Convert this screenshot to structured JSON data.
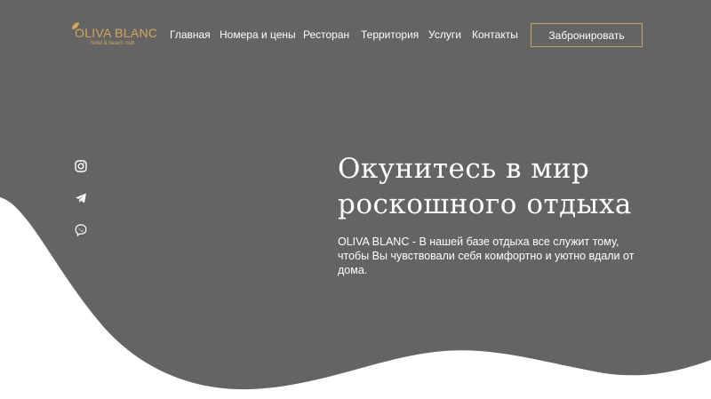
{
  "colors": {
    "background": "#646464",
    "accent_gold": "#d4a45a",
    "wave_cream": "#fbf7ee",
    "wave_white": "#ffffff",
    "text": "#ffffff"
  },
  "logo": {
    "title": "OLIVA BLANC",
    "subtitle": "hotel & beach club",
    "icon": "olive-leaf-icon"
  },
  "nav": {
    "items": [
      {
        "label": "Главная"
      },
      {
        "label": "Номера и цены"
      },
      {
        "label": "Ресторан"
      },
      {
        "label": "Территория"
      },
      {
        "label": "Услуги"
      },
      {
        "label": "Контакты"
      }
    ],
    "book_label": "Забронировать"
  },
  "social": [
    {
      "icon": "instagram-icon"
    },
    {
      "icon": "telegram-icon"
    },
    {
      "icon": "viber-icon"
    }
  ],
  "hero": {
    "title_line1": "Окунитесь в мир",
    "title_line2": "роскошного отдыха",
    "text": "OLIVA BLANC - В нашей базе отдыха все служит тому, чтобы Вы чувствовали себя комфортно и уютно вдали от дома."
  }
}
